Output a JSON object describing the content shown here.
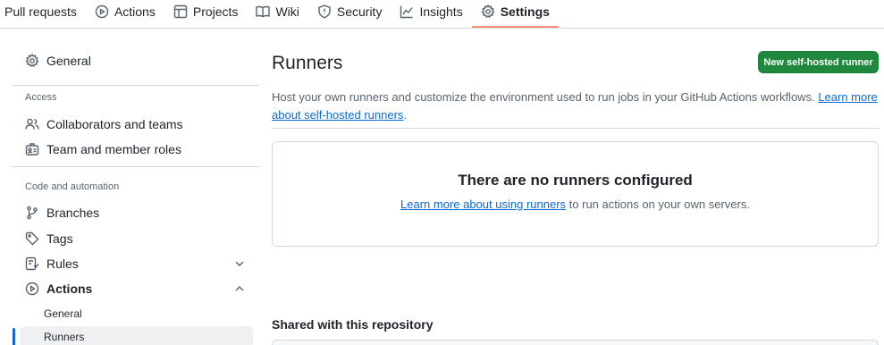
{
  "topnav": {
    "tabs": [
      {
        "label": "Pull requests",
        "icon": "none"
      },
      {
        "label": "Actions",
        "icon": "play-icon"
      },
      {
        "label": "Projects",
        "icon": "table-icon"
      },
      {
        "label": "Wiki",
        "icon": "book-icon"
      },
      {
        "label": "Security",
        "icon": "shield-icon"
      },
      {
        "label": "Insights",
        "icon": "graph-icon"
      },
      {
        "label": "Settings",
        "icon": "gear-icon",
        "active": true
      }
    ]
  },
  "sidebar": {
    "general": "General",
    "access_heading": "Access",
    "collaborators": "Collaborators and teams",
    "team_roles": "Team and member roles",
    "code_heading": "Code and automation",
    "branches": "Branches",
    "tags": "Tags",
    "rules": "Rules",
    "actions": "Actions",
    "actions_general": "General",
    "actions_runners": "Runners"
  },
  "main": {
    "title": "Runners",
    "new_button": "New self-hosted runner",
    "description": "Host your own runners and customize the environment used to run jobs in your GitHub Actions workflows.",
    "learn_more_link": "Learn more about self-hosted runners",
    "blank_title": "There are no runners configured",
    "blank_link": "Learn more about using runners",
    "blank_text": "to run actions on your own servers.",
    "shared_title": "Shared with this repository"
  },
  "colors": {
    "accent": "#0969da",
    "button_green": "#1f883d",
    "active_tab_underline": "#fd8c73"
  }
}
